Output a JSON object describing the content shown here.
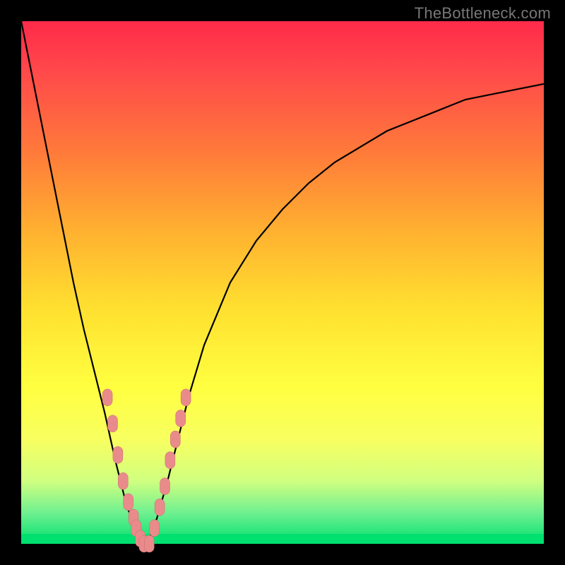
{
  "watermark": "TheBottleneck.com",
  "chart_data": {
    "type": "line",
    "title": "",
    "xlabel": "",
    "ylabel": "",
    "xlim": [
      0,
      100
    ],
    "ylim": [
      0,
      100
    ],
    "series": [
      {
        "name": "bottleneck-curve",
        "x": [
          0,
          2,
          4,
          6,
          8,
          10,
          12,
          14,
          16,
          18,
          19,
          20,
          21,
          22,
          23,
          24,
          25,
          26,
          28,
          30,
          32,
          35,
          40,
          45,
          50,
          55,
          60,
          65,
          70,
          75,
          80,
          85,
          90,
          95,
          100
        ],
        "y": [
          100,
          90,
          80,
          70,
          60,
          50,
          41,
          33,
          25,
          16,
          12,
          8,
          5,
          2,
          0,
          0,
          2,
          5,
          12,
          20,
          28,
          38,
          50,
          58,
          64,
          69,
          73,
          76,
          79,
          81,
          83,
          85,
          86,
          87,
          88
        ]
      }
    ],
    "highlight_clusters": [
      {
        "name": "left-arm-dots",
        "points": [
          {
            "x": 16.5,
            "y": 28
          },
          {
            "x": 17.5,
            "y": 23
          },
          {
            "x": 18.5,
            "y": 17
          },
          {
            "x": 19.5,
            "y": 12
          },
          {
            "x": 20.5,
            "y": 8
          },
          {
            "x": 21.5,
            "y": 5
          },
          {
            "x": 22.0,
            "y": 3
          },
          {
            "x": 22.8,
            "y": 1
          }
        ]
      },
      {
        "name": "valley-dots",
        "points": [
          {
            "x": 23.5,
            "y": 0
          },
          {
            "x": 24.5,
            "y": 0
          }
        ]
      },
      {
        "name": "right-arm-dots",
        "points": [
          {
            "x": 25.5,
            "y": 3
          },
          {
            "x": 26.5,
            "y": 7
          },
          {
            "x": 27.5,
            "y": 11
          },
          {
            "x": 28.5,
            "y": 16
          },
          {
            "x": 29.5,
            "y": 20
          },
          {
            "x": 30.5,
            "y": 24
          },
          {
            "x": 31.5,
            "y": 28
          }
        ]
      }
    ],
    "colors": {
      "curve": "#000000",
      "highlight_fill": "#e98b8b",
      "highlight_stroke": "#c96b6b",
      "gradient_top": "#ff2a4a",
      "gradient_bottom": "#00e070"
    }
  }
}
